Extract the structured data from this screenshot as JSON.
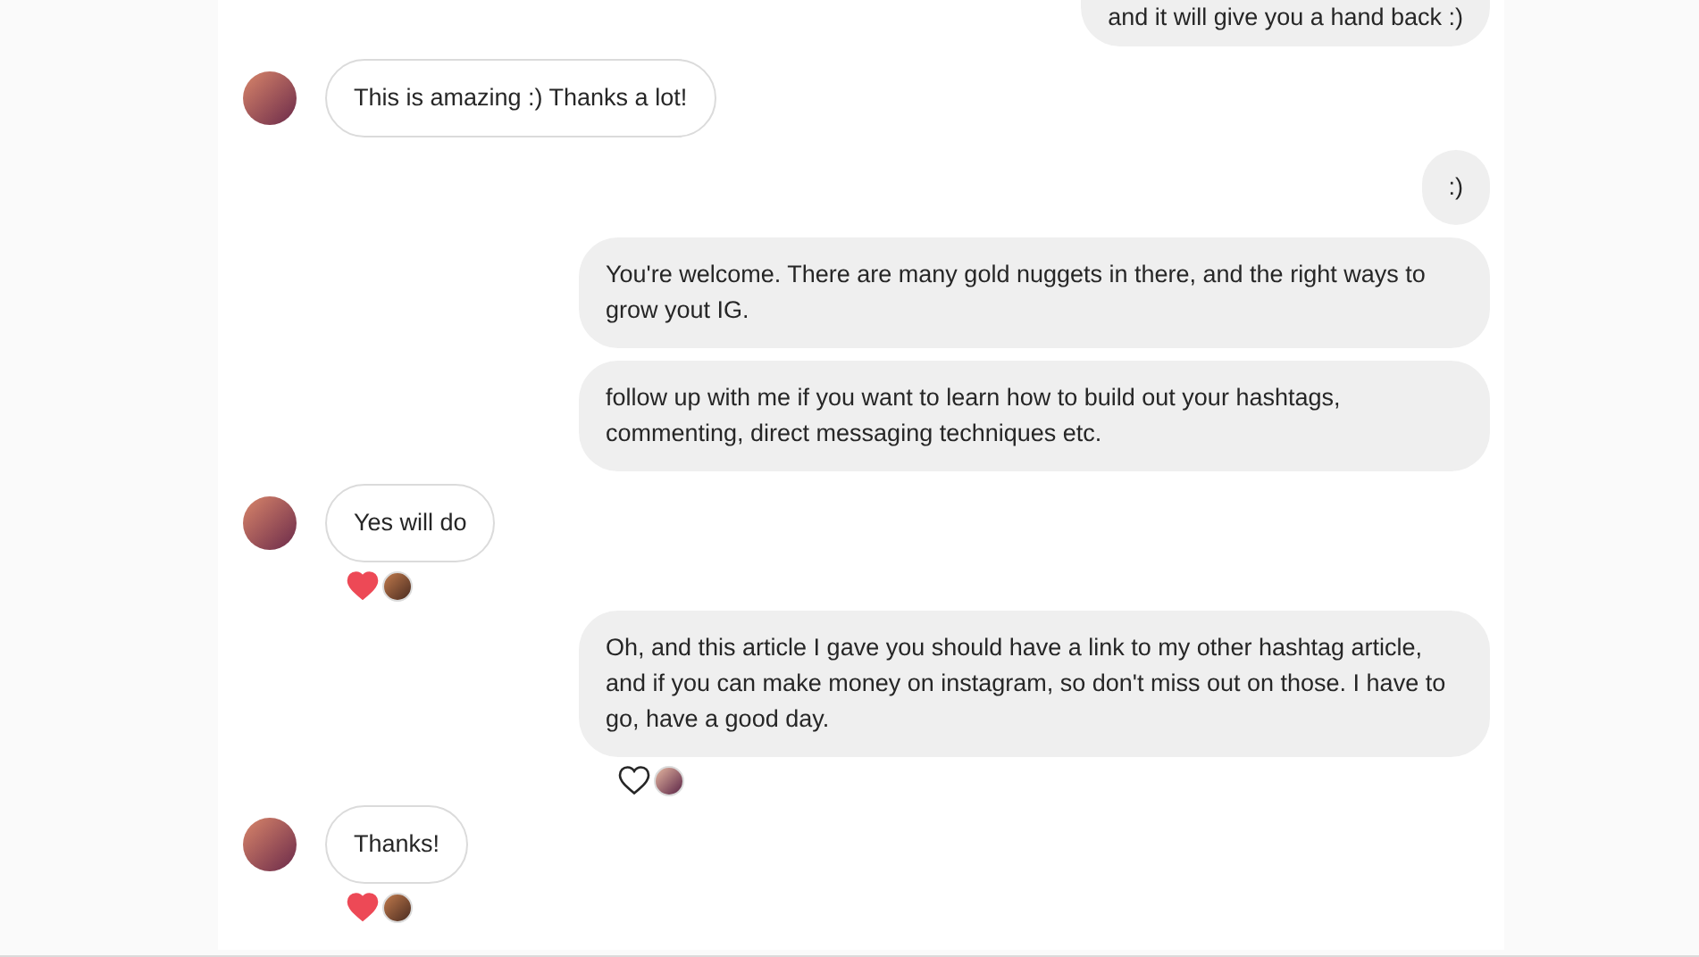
{
  "messages": [
    {
      "kind": "sent",
      "text": "and it will give you a hand back :)"
    },
    {
      "kind": "received",
      "text": "This is amazing :) Thanks a lot!"
    },
    {
      "kind": "sent",
      "text": ":)"
    },
    {
      "kind": "sent",
      "text": "You're welcome. There are many gold nuggets in there, and the right ways to grow yout IG."
    },
    {
      "kind": "sent",
      "text": "follow up with me if you want to learn how to build out your hashtags, commenting, direct messaging techniques etc."
    },
    {
      "kind": "received",
      "text": "Yes will do",
      "reaction": {
        "liked": true
      }
    },
    {
      "kind": "sent",
      "text": "Oh, and this article I gave you should have a link to my other hashtag article, and if you can make money on instagram, so don't miss out on those. I have to go, have a good day.",
      "reaction": {
        "liked": false
      }
    },
    {
      "kind": "received",
      "text": "Thanks!",
      "reaction": {
        "liked": true
      }
    }
  ]
}
